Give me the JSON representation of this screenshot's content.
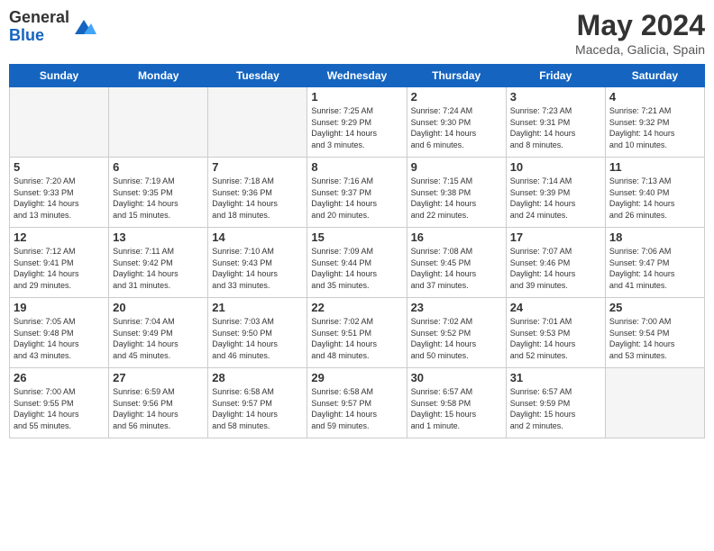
{
  "header": {
    "logo_general": "General",
    "logo_blue": "Blue",
    "month_year": "May 2024",
    "location": "Maceda, Galicia, Spain"
  },
  "weekdays": [
    "Sunday",
    "Monday",
    "Tuesday",
    "Wednesday",
    "Thursday",
    "Friday",
    "Saturday"
  ],
  "weeks": [
    [
      {
        "day": "",
        "info": ""
      },
      {
        "day": "",
        "info": ""
      },
      {
        "day": "",
        "info": ""
      },
      {
        "day": "1",
        "info": "Sunrise: 7:25 AM\nSunset: 9:29 PM\nDaylight: 14 hours\nand 3 minutes."
      },
      {
        "day": "2",
        "info": "Sunrise: 7:24 AM\nSunset: 9:30 PM\nDaylight: 14 hours\nand 6 minutes."
      },
      {
        "day": "3",
        "info": "Sunrise: 7:23 AM\nSunset: 9:31 PM\nDaylight: 14 hours\nand 8 minutes."
      },
      {
        "day": "4",
        "info": "Sunrise: 7:21 AM\nSunset: 9:32 PM\nDaylight: 14 hours\nand 10 minutes."
      }
    ],
    [
      {
        "day": "5",
        "info": "Sunrise: 7:20 AM\nSunset: 9:33 PM\nDaylight: 14 hours\nand 13 minutes."
      },
      {
        "day": "6",
        "info": "Sunrise: 7:19 AM\nSunset: 9:35 PM\nDaylight: 14 hours\nand 15 minutes."
      },
      {
        "day": "7",
        "info": "Sunrise: 7:18 AM\nSunset: 9:36 PM\nDaylight: 14 hours\nand 18 minutes."
      },
      {
        "day": "8",
        "info": "Sunrise: 7:16 AM\nSunset: 9:37 PM\nDaylight: 14 hours\nand 20 minutes."
      },
      {
        "day": "9",
        "info": "Sunrise: 7:15 AM\nSunset: 9:38 PM\nDaylight: 14 hours\nand 22 minutes."
      },
      {
        "day": "10",
        "info": "Sunrise: 7:14 AM\nSunset: 9:39 PM\nDaylight: 14 hours\nand 24 minutes."
      },
      {
        "day": "11",
        "info": "Sunrise: 7:13 AM\nSunset: 9:40 PM\nDaylight: 14 hours\nand 26 minutes."
      }
    ],
    [
      {
        "day": "12",
        "info": "Sunrise: 7:12 AM\nSunset: 9:41 PM\nDaylight: 14 hours\nand 29 minutes."
      },
      {
        "day": "13",
        "info": "Sunrise: 7:11 AM\nSunset: 9:42 PM\nDaylight: 14 hours\nand 31 minutes."
      },
      {
        "day": "14",
        "info": "Sunrise: 7:10 AM\nSunset: 9:43 PM\nDaylight: 14 hours\nand 33 minutes."
      },
      {
        "day": "15",
        "info": "Sunrise: 7:09 AM\nSunset: 9:44 PM\nDaylight: 14 hours\nand 35 minutes."
      },
      {
        "day": "16",
        "info": "Sunrise: 7:08 AM\nSunset: 9:45 PM\nDaylight: 14 hours\nand 37 minutes."
      },
      {
        "day": "17",
        "info": "Sunrise: 7:07 AM\nSunset: 9:46 PM\nDaylight: 14 hours\nand 39 minutes."
      },
      {
        "day": "18",
        "info": "Sunrise: 7:06 AM\nSunset: 9:47 PM\nDaylight: 14 hours\nand 41 minutes."
      }
    ],
    [
      {
        "day": "19",
        "info": "Sunrise: 7:05 AM\nSunset: 9:48 PM\nDaylight: 14 hours\nand 43 minutes."
      },
      {
        "day": "20",
        "info": "Sunrise: 7:04 AM\nSunset: 9:49 PM\nDaylight: 14 hours\nand 45 minutes."
      },
      {
        "day": "21",
        "info": "Sunrise: 7:03 AM\nSunset: 9:50 PM\nDaylight: 14 hours\nand 46 minutes."
      },
      {
        "day": "22",
        "info": "Sunrise: 7:02 AM\nSunset: 9:51 PM\nDaylight: 14 hours\nand 48 minutes."
      },
      {
        "day": "23",
        "info": "Sunrise: 7:02 AM\nSunset: 9:52 PM\nDaylight: 14 hours\nand 50 minutes."
      },
      {
        "day": "24",
        "info": "Sunrise: 7:01 AM\nSunset: 9:53 PM\nDaylight: 14 hours\nand 52 minutes."
      },
      {
        "day": "25",
        "info": "Sunrise: 7:00 AM\nSunset: 9:54 PM\nDaylight: 14 hours\nand 53 minutes."
      }
    ],
    [
      {
        "day": "26",
        "info": "Sunrise: 7:00 AM\nSunset: 9:55 PM\nDaylight: 14 hours\nand 55 minutes."
      },
      {
        "day": "27",
        "info": "Sunrise: 6:59 AM\nSunset: 9:56 PM\nDaylight: 14 hours\nand 56 minutes."
      },
      {
        "day": "28",
        "info": "Sunrise: 6:58 AM\nSunset: 9:57 PM\nDaylight: 14 hours\nand 58 minutes."
      },
      {
        "day": "29",
        "info": "Sunrise: 6:58 AM\nSunset: 9:57 PM\nDaylight: 14 hours\nand 59 minutes."
      },
      {
        "day": "30",
        "info": "Sunrise: 6:57 AM\nSunset: 9:58 PM\nDaylight: 15 hours\nand 1 minute."
      },
      {
        "day": "31",
        "info": "Sunrise: 6:57 AM\nSunset: 9:59 PM\nDaylight: 15 hours\nand 2 minutes."
      },
      {
        "day": "",
        "info": ""
      }
    ]
  ]
}
